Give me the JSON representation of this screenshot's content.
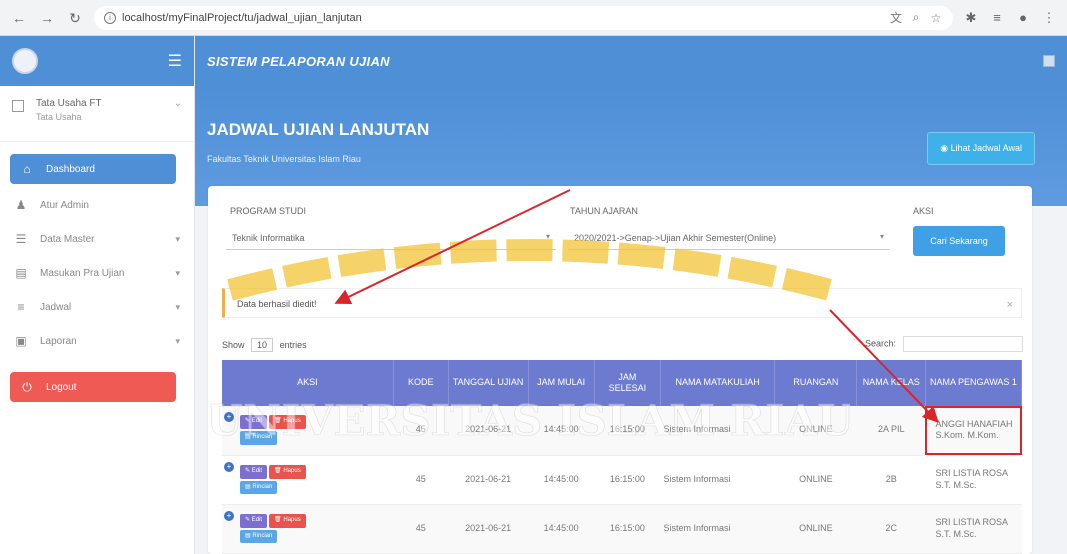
{
  "browser": {
    "url": "localhost/myFinalProject/tu/jadwal_ujian_lanjutan"
  },
  "sidebar": {
    "user_name": "Tata Usaha FT",
    "user_role": "Tata Usaha",
    "items": [
      {
        "label": "Dashboard",
        "icon": "home-icon"
      },
      {
        "label": "Atur Admin",
        "icon": "user-icon"
      },
      {
        "label": "Data Master",
        "icon": "database-icon"
      },
      {
        "label": "Masukan Pra Ujian",
        "icon": "clipboard-icon"
      },
      {
        "label": "Jadwal",
        "icon": "list-icon"
      },
      {
        "label": "Laporan",
        "icon": "report-icon"
      },
      {
        "label": "Logout",
        "icon": "power-icon"
      }
    ]
  },
  "header": {
    "app_title": "SISTEM PELAPORAN UJIAN",
    "page_title": "JADWAL UJIAN LANJUTAN",
    "page_subtitle": "Fakultas Teknik Universitas Islam Riau",
    "lihat_button": "Lihat Jadwal Awal"
  },
  "filters": {
    "program_label": "PROGRAM STUDI",
    "program_value": "Teknik Informatika",
    "tahun_label": "TAHUN AJARAN",
    "tahun_value": "2020/2021->Genap->Ujian Akhir Semester(Online)",
    "aksi_label": "AKSI",
    "cari_button": "Cari Sekarang"
  },
  "alert": {
    "message": "Data berhasil diedit!"
  },
  "table_controls": {
    "show": "Show",
    "entries_value": "10",
    "entries": "entries",
    "search_label": "Search:"
  },
  "table": {
    "headers": [
      "AKSI",
      "KODE",
      "TANGGAL UJIAN",
      "JAM MULAI",
      "JAM SELESAI",
      "NAMA MATAKULIAH",
      "RUANGAN",
      "NAMA KELAS",
      "NAMA PENGAWAS 1"
    ],
    "action_labels": {
      "edit": "Edit",
      "hapus": "Hapus",
      "rincian": "Rincian"
    },
    "rows": [
      {
        "kode": "45",
        "tanggal": "2021-06-21",
        "mulai": "14:45:00",
        "selesai": "16:15:00",
        "matakuliah": "Sistem Informasi",
        "ruangan": "ONLINE",
        "kelas": "2A PIL",
        "pengawas": "ANGGI HANAFIAH S.Kom. M.Kom."
      },
      {
        "kode": "45",
        "tanggal": "2021-06-21",
        "mulai": "14:45:00",
        "selesai": "16:15:00",
        "matakuliah": "Sistem Informasi",
        "ruangan": "ONLINE",
        "kelas": "2B",
        "pengawas": "SRI LISTIA ROSA S.T. M.Sc."
      },
      {
        "kode": "45",
        "tanggal": "2021-06-21",
        "mulai": "14:45:00",
        "selesai": "16:15:00",
        "matakuliah": "Sistem Informasi",
        "ruangan": "ONLINE",
        "kelas": "2C",
        "pengawas": "SRI LISTIA ROSA S.T. M.Sc."
      }
    ]
  },
  "watermark": "UNIVERSITAS ISLAM RIAU",
  "colors": {
    "primary": "#4e8fd6",
    "header_table": "#6c7bd0",
    "danger": "#ef5b54",
    "annotation": "#d8262b"
  }
}
